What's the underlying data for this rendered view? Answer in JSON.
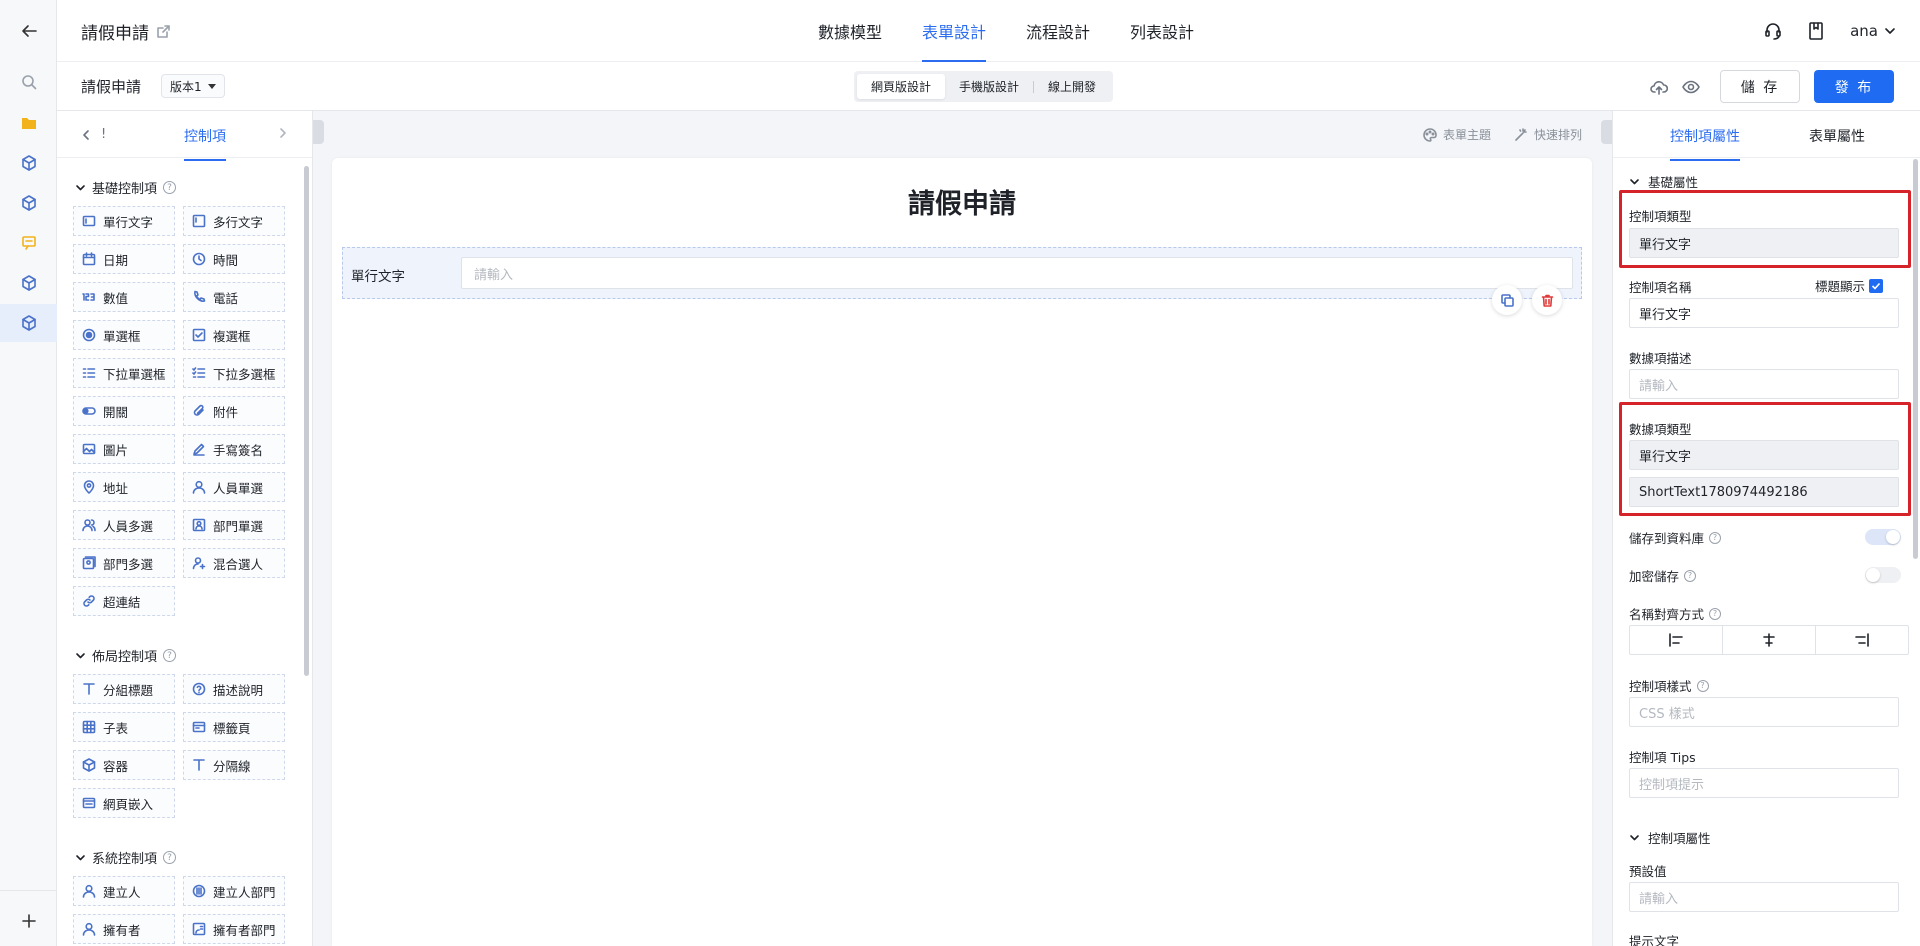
{
  "rail": {
    "items": [
      {
        "icon": "back-arrow-icon"
      },
      {
        "icon": "search-icon"
      },
      {
        "icon": "folder-icon"
      },
      {
        "icon": "cube-icon"
      },
      {
        "icon": "cube-icon"
      },
      {
        "icon": "chat-icon"
      },
      {
        "icon": "cube-icon"
      },
      {
        "icon": "cube-icon"
      },
      {
        "icon": "plus-icon"
      }
    ]
  },
  "header": {
    "title": "請假申請",
    "tabs": [
      "數據模型",
      "表單設計",
      "流程設計",
      "列表設計"
    ],
    "active_tab": "表單設計",
    "user": "ana"
  },
  "toolbar": {
    "form_name": "請假申請",
    "version": "版本1",
    "modes": [
      "網頁版設計",
      "手機版設計",
      "線上開發"
    ],
    "save_label": "儲 存",
    "publish_label": "發 布"
  },
  "left_panel": {
    "nav_label": "!",
    "tab_label": "控制項",
    "groups": {
      "basic": {
        "title": "基礎控制項",
        "items": [
          "單行文字",
          "多行文字",
          "日期",
          "時間",
          "數值",
          "電話",
          "單選框",
          "複選框",
          "下拉單選框",
          "下拉多選框",
          "開關",
          "附件",
          "圖片",
          "手寫簽名",
          "地址",
          "人員單選",
          "人員多選",
          "部門單選",
          "部門多選",
          "混合選人",
          "超連結"
        ]
      },
      "layout": {
        "title": "佈局控制項",
        "items": [
          "分組標題",
          "描述說明",
          "子表",
          "標籤頁",
          "容器",
          "分隔線",
          "網頁嵌入"
        ]
      },
      "system": {
        "title": "系統控制項",
        "items": [
          "建立人",
          "建立人部門",
          "擁有者",
          "擁有者部門"
        ]
      }
    }
  },
  "canvas": {
    "theme_label": "表單主題",
    "arrange_label": "快速排列",
    "form_title": "請假申請",
    "field": {
      "label": "單行文字",
      "placeholder": "請輸入"
    }
  },
  "right_panel": {
    "tabs": [
      "控制項屬性",
      "表單屬性"
    ],
    "basic_section": "基礎屬性",
    "control_type_label": "控制項類型",
    "control_type_value": "單行文字",
    "control_name_label": "控制項名稱",
    "show_title_label": "標題顯示",
    "control_name_value": "單行文字",
    "data_desc_label": "數據項描述",
    "data_desc_placeholder": "請輸入",
    "data_type_label": "數據項類型",
    "data_type_value": "單行文字",
    "data_key_value": "ShortText1780974492186",
    "save_db_label": "儲存到資料庫",
    "save_db_on": true,
    "encrypt_label": "加密儲存",
    "encrypt_on": false,
    "align_label": "名稱對齊方式",
    "style_label": "控制項樣式",
    "style_placeholder": "CSS 樣式",
    "tips_label": "控制項 Tips",
    "tips_placeholder": "控制項提示",
    "control_section": "控制項屬性",
    "default_label": "預設值",
    "default_placeholder": "請輸入",
    "hint_label": "提示文字"
  },
  "colors": {
    "accent": "#1f6cf2",
    "highlight_box": "#d6232a",
    "delete": "#e03b3b"
  }
}
